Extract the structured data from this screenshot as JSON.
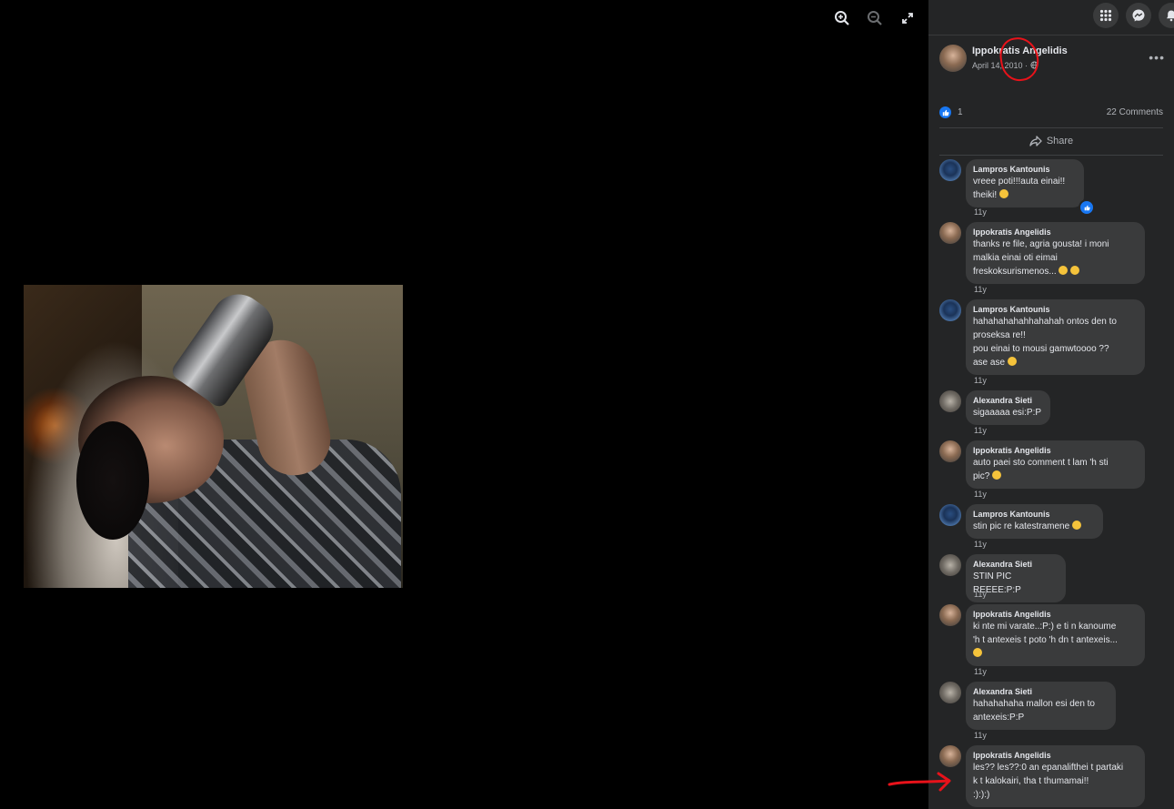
{
  "viewer": {
    "tools": [
      "zoom-in-icon",
      "zoom-out-icon",
      "fullscreen-icon"
    ]
  },
  "topbar": {
    "icons": [
      "menu-grid-icon",
      "messenger-icon",
      "notifications-icon"
    ]
  },
  "post": {
    "author": "Ippokratis Angelidis",
    "date": "April 14, 2010 ·",
    "likes": "1",
    "comments_count": "22 Comments",
    "share_label": "Share"
  },
  "comments": [
    {
      "name": "Lampros Kantounis",
      "text": "vreee poti!!!auta einai!!\ntheiki!",
      "time": "11y"
    },
    {
      "name": "Ippokratis Angelidis",
      "text": "thanks re file, agria gousta! i moni\nmalkia einai oti eimai\nfreskoksurismenos...",
      "time": "11y"
    },
    {
      "name": "Lampros Kantounis",
      "text": "hahahahahahhahahah ontos den to\nproseksa re!!\npou einai to mousi gamwtoooo ??\nase ase",
      "time": "11y"
    },
    {
      "name": "Alexandra Sieti",
      "text": "sigaaaaa esi:P:P",
      "time": "11y"
    },
    {
      "name": "Ippokratis Angelidis",
      "text": "auto paei sto comment t lam 'h sti\npic?",
      "time": "11y"
    },
    {
      "name": "Lampros Kantounis",
      "text": "stin pic re katestramene",
      "time": "11y"
    },
    {
      "name": "Alexandra Sieti",
      "text": "STIN PIC REEEE:P:P",
      "time": "11y"
    },
    {
      "name": "Ippokratis Angelidis",
      "text": "ki nte mi varate..:P:) e ti n kanoume\n'h t antexeis t poto 'h dn t antexeis...",
      "time": "11y"
    },
    {
      "name": "Alexandra Sieti",
      "text": "hahahahaha mallon esi den to\nantexeis:P:P",
      "time": "11y"
    },
    {
      "name": "Ippokratis Angelidis",
      "text": "les?? les??:0 an epanalifthei t partaki\nk t kalokairi, tha t thumamai!!\n:):):)",
      "time": ""
    }
  ],
  "colors": {
    "panel_bg": "#242526",
    "bubble_bg": "#3a3b3c",
    "text": "#e4e6eb",
    "muted": "#b0b3b8",
    "like_blue": "#1877f2",
    "annotation_red": "#e8121a"
  }
}
